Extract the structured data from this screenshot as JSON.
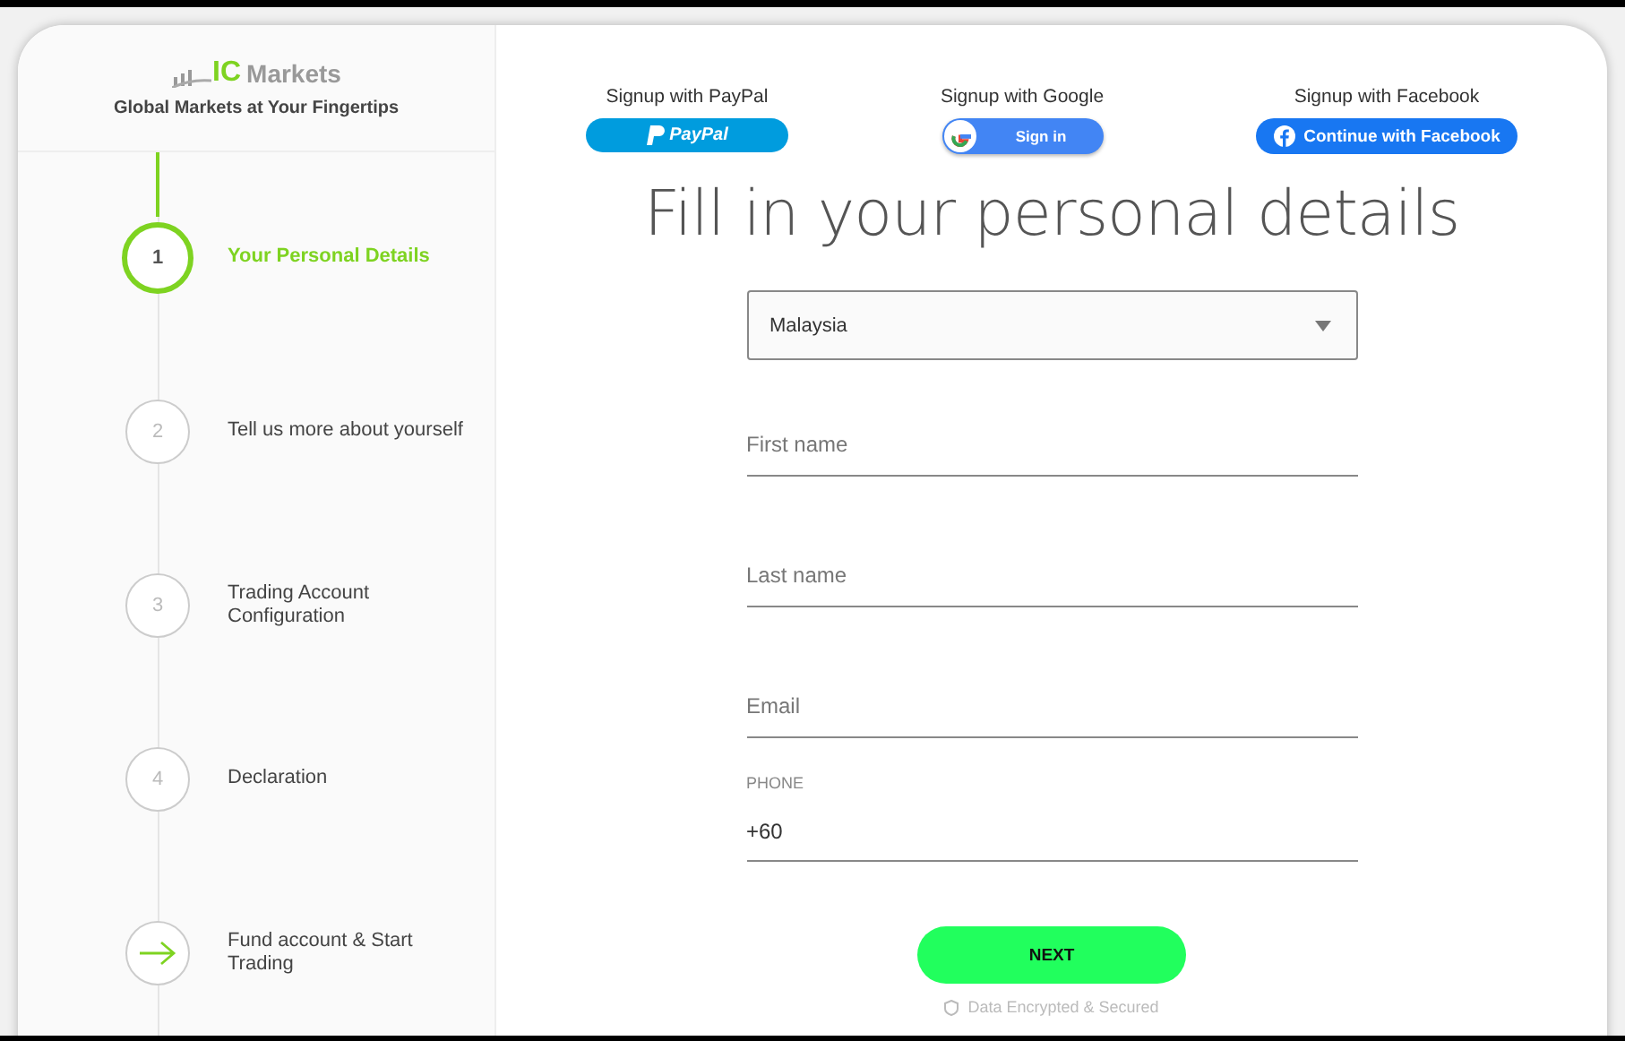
{
  "brand": {
    "logo_ic": "IC",
    "logo_name": "Markets",
    "tagline": "Global Markets at Your Fingertips"
  },
  "steps": [
    {
      "kind": "number",
      "number": "1",
      "label": "Your Personal Details",
      "selected": true
    },
    {
      "kind": "number",
      "number": "2",
      "label": "Tell us more about yourself",
      "selected": false
    },
    {
      "kind": "number",
      "number": "3",
      "label": "Trading Account Configuration",
      "selected": false
    },
    {
      "kind": "number",
      "number": "4",
      "label": "Declaration",
      "selected": false
    },
    {
      "kind": "arrow",
      "label": "Fund account & Start Trading",
      "selected": false
    }
  ],
  "social": [
    {
      "kind": "paypal",
      "caption": "Signup with PayPal",
      "button": "PayPal"
    },
    {
      "kind": "google",
      "caption": "Signup with Google",
      "button": "Sign in"
    },
    {
      "kind": "facebook",
      "caption": "Signup with Facebook",
      "button": "Continue with Facebook"
    }
  ],
  "title": "Fill in your personal details",
  "country": {
    "value": "Malaysia"
  },
  "fields": [
    {
      "kind": "text",
      "placeholder": "First name"
    },
    {
      "kind": "text",
      "placeholder": "Last name"
    },
    {
      "kind": "text",
      "placeholder": "Email"
    },
    {
      "kind": "phone",
      "label": "PHONE",
      "value": "+60"
    }
  ],
  "next_button": "NEXT",
  "footer": "Data Encrypted & Secured"
}
